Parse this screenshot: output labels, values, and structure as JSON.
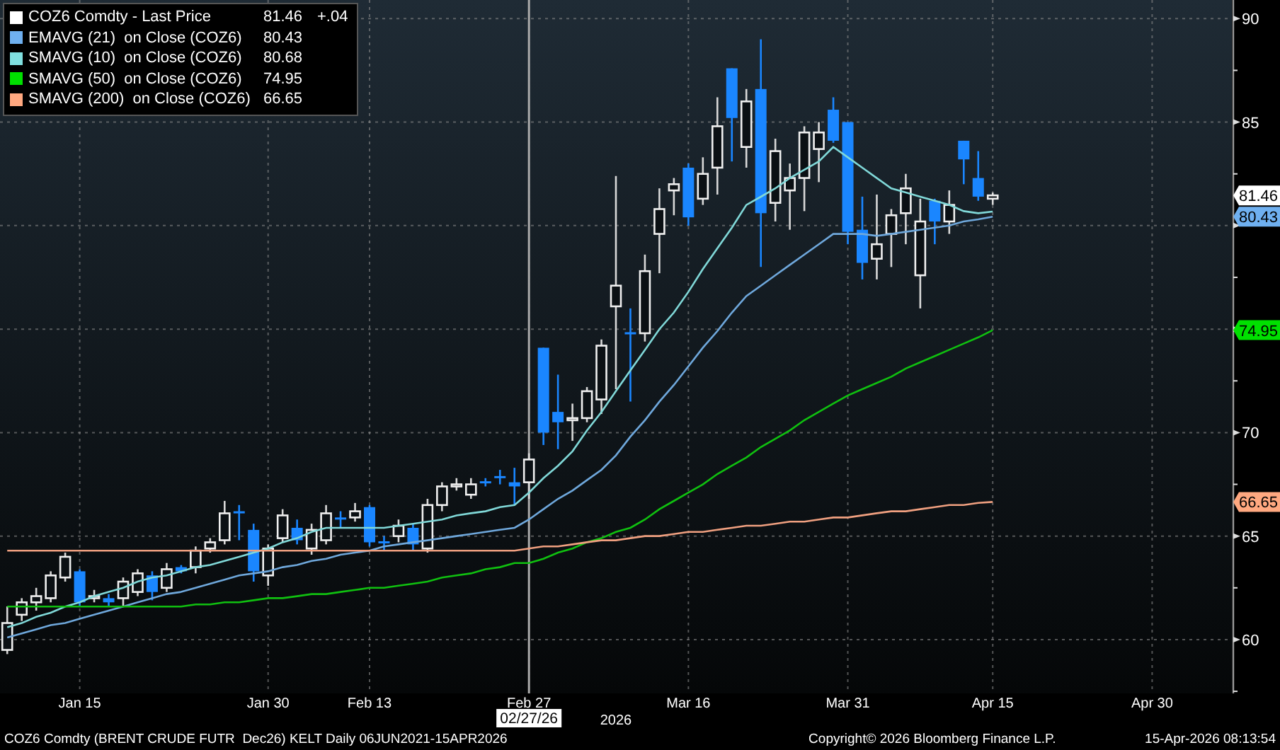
{
  "legend": {
    "items": [
      {
        "label": "COZ6 Comdty - Last Price",
        "value": "81.46",
        "change": "+.04",
        "color": "#ffffff",
        "tag": "81.46"
      },
      {
        "text": "on Close (COZ6)",
        "value": "80.43",
        "color": "#6fb0f0",
        "tag": "80.43"
      },
      {
        "text": "on Close (COZ6)",
        "value": "80.68",
        "color": "#80e0e0"
      },
      {
        "text": "on Close (COZ6)",
        "value": "74.95",
        "color": "#00e000",
        "tag": "74.95"
      },
      {
        "text": "on Close (COZ6)",
        "value": "66.65",
        "color": "#ffa880",
        "tag": "66.65"
      }
    ]
  },
  "chart_data": {
    "type": "candlestick",
    "ylim": [
      57.4,
      90.9
    ],
    "grid": true,
    "categories": [
      null,
      null,
      null,
      null,
      null,
      "Jan 15",
      null,
      null,
      null,
      null,
      null,
      null,
      null,
      null,
      null,
      null,
      null,
      null,
      "Jan 30",
      null,
      null,
      null,
      null,
      null,
      null,
      "Feb 13",
      null,
      null,
      null,
      null,
      null,
      null,
      null,
      null,
      null,
      null,
      "Feb 27",
      null,
      null,
      null,
      null,
      null,
      null,
      null,
      null,
      null,
      null,
      "Mar 16",
      null,
      null,
      null,
      null,
      null,
      null,
      null,
      null,
      null,
      null,
      "Mar 31",
      null,
      null,
      null,
      null,
      null,
      null,
      null,
      null,
      null,
      "Apr 15",
      null,
      null,
      null,
      null,
      null,
      null,
      null,
      null,
      null,
      null,
      "Apr 30",
      null,
      null,
      null,
      null,
      null
    ],
    "yticks": [
      60,
      65,
      70,
      85,
      90
    ],
    "ohlc": [
      [
        59.5,
        61.6,
        59.3,
        60.8
      ],
      [
        61.2,
        62.0,
        60.9,
        61.8
      ],
      [
        61.8,
        62.5,
        61.4,
        62.1
      ],
      [
        62.0,
        63.3,
        61.8,
        63.1
      ],
      [
        63.0,
        64.2,
        62.8,
        64.0
      ],
      [
        63.3,
        63.4,
        61.6,
        61.8
      ],
      [
        62.0,
        62.4,
        61.8,
        62.1
      ],
      [
        62.0,
        62.2,
        61.6,
        61.8
      ],
      [
        62.0,
        63.0,
        61.6,
        62.8
      ],
      [
        62.3,
        63.4,
        62.1,
        63.2
      ],
      [
        63.1,
        63.3,
        61.9,
        62.3
      ],
      [
        62.5,
        63.7,
        62.3,
        63.4
      ],
      [
        63.5,
        63.6,
        63.2,
        63.3
      ],
      [
        63.5,
        64.5,
        63.2,
        64.3
      ],
      [
        64.4,
        64.9,
        64.2,
        64.7
      ],
      [
        64.8,
        66.7,
        64.6,
        66.1
      ],
      [
        66.2,
        66.5,
        64.8,
        66.1
      ],
      [
        65.3,
        65.6,
        62.8,
        63.3
      ],
      [
        63.1,
        64.6,
        62.6,
        64.4
      ],
      [
        64.9,
        66.3,
        64.7,
        66.0
      ],
      [
        65.4,
        65.8,
        64.6,
        64.8
      ],
      [
        64.4,
        65.6,
        64.1,
        65.3
      ],
      [
        64.8,
        66.5,
        64.6,
        66.1
      ],
      [
        65.9,
        66.2,
        65.4,
        65.8
      ],
      [
        65.9,
        66.6,
        65.7,
        66.2
      ],
      [
        66.4,
        66.5,
        64.5,
        64.7
      ],
      [
        64.75,
        65.0,
        64.3,
        64.7
      ],
      [
        65.0,
        65.8,
        64.7,
        65.5
      ],
      [
        65.4,
        65.6,
        64.3,
        64.6
      ],
      [
        64.4,
        66.8,
        64.2,
        66.5
      ],
      [
        66.5,
        67.6,
        66.2,
        67.4
      ],
      [
        67.4,
        67.8,
        67.2,
        67.5
      ],
      [
        67.0,
        67.8,
        66.8,
        67.5
      ],
      [
        67.65,
        67.8,
        67.4,
        67.6
      ],
      [
        67.9,
        68.2,
        67.5,
        67.8
      ],
      [
        67.6,
        68.3,
        66.5,
        67.4
      ],
      [
        67.6,
        69.0,
        66.8,
        68.7
      ],
      [
        74.1,
        74.1,
        69.4,
        70.0
      ],
      [
        71.0,
        72.8,
        69.2,
        70.5
      ],
      [
        70.6,
        71.4,
        69.6,
        70.7
      ],
      [
        70.7,
        72.2,
        70.5,
        72.0
      ],
      [
        71.6,
        74.5,
        70.9,
        74.2
      ],
      [
        76.1,
        82.4,
        72.1,
        77.1
      ],
      [
        74.85,
        76.0,
        71.5,
        74.75
      ],
      [
        74.8,
        78.6,
        74.4,
        77.8
      ],
      [
        79.6,
        81.8,
        77.7,
        80.8
      ],
      [
        81.7,
        82.3,
        80.5,
        82.0
      ],
      [
        82.8,
        83.0,
        80.0,
        80.4
      ],
      [
        81.3,
        83.3,
        81.0,
        82.5
      ],
      [
        82.8,
        86.2,
        81.5,
        84.8
      ],
      [
        87.6,
        87.6,
        83.1,
        85.2
      ],
      [
        83.8,
        86.6,
        82.8,
        86.0
      ],
      [
        86.6,
        89.0,
        78.0,
        80.6
      ],
      [
        81.1,
        84.2,
        80.2,
        83.6
      ],
      [
        81.7,
        83.0,
        79.8,
        82.3
      ],
      [
        82.3,
        84.8,
        80.7,
        84.5
      ],
      [
        83.7,
        85.0,
        82.1,
        84.5
      ],
      [
        85.6,
        86.2,
        84.0,
        84.1
      ],
      [
        85.0,
        85.0,
        79.1,
        79.7
      ],
      [
        79.8,
        81.4,
        77.4,
        78.2
      ],
      [
        78.4,
        81.5,
        77.4,
        79.1
      ],
      [
        79.6,
        80.8,
        78.0,
        80.5
      ],
      [
        80.6,
        82.5,
        79.1,
        81.8
      ],
      [
        77.6,
        81.3,
        76.0,
        80.2
      ],
      [
        81.2,
        81.3,
        79.1,
        80.2
      ],
      [
        80.2,
        81.7,
        79.6,
        81.0
      ],
      [
        84.1,
        84.1,
        82.0,
        83.2
      ],
      [
        82.3,
        83.6,
        81.2,
        81.4
      ],
      [
        81.3,
        81.6,
        81.0,
        81.46
      ],
      null,
      null,
      null,
      null,
      null,
      null,
      null,
      null,
      null,
      null,
      null,
      null,
      null,
      null,
      null,
      null
    ],
    "annotations": [
      "02/27/26"
    ]
  },
  "moving_averages": {
    "chart_data": {
      "type": "line",
      "ylim": [
        57.4,
        90.9
      ],
      "categories": [
        null,
        null,
        null,
        null,
        null,
        null,
        null,
        null,
        null,
        null,
        null,
        null,
        null,
        null,
        null,
        null,
        null,
        null,
        null,
        null,
        null,
        null,
        null,
        null,
        null,
        null,
        null,
        null,
        null,
        null,
        null,
        null,
        null,
        null,
        null,
        null,
        null,
        null,
        null,
        null,
        null,
        null,
        null,
        null,
        null,
        null,
        null,
        null,
        null,
        null,
        null,
        null,
        null,
        null,
        null,
        null,
        null,
        null,
        null,
        null,
        null,
        null,
        null,
        null,
        null,
        null,
        null,
        null,
        null,
        null,
        null,
        null,
        null,
        null,
        null,
        null,
        null,
        null,
        null,
        null,
        null,
        null,
        null,
        null,
        null
      ],
      "series": [
        {
          "name": "EMAVG (21)",
          "color": "#6fa8dc",
          "values": [
            60.1,
            60.3,
            60.5,
            60.7,
            60.8,
            61.0,
            61.2,
            61.4,
            61.6,
            61.8,
            62.0,
            62.2,
            62.3,
            62.5,
            62.7,
            62.9,
            63.1,
            63.2,
            63.3,
            63.5,
            63.6,
            63.8,
            63.9,
            64.1,
            64.2,
            64.3,
            64.5,
            64.6,
            64.7,
            64.8,
            64.9,
            65.0,
            65.1,
            65.2,
            65.3,
            65.4,
            65.8,
            66.3,
            66.8,
            67.2,
            67.7,
            68.2,
            68.9,
            69.8,
            70.6,
            71.5,
            72.3,
            73.2,
            74.1,
            74.9,
            75.8,
            76.6,
            77.1,
            77.6,
            78.1,
            78.6,
            79.1,
            79.6,
            79.6,
            79.6,
            79.5,
            79.6,
            79.7,
            79.8,
            79.9,
            80.0,
            80.2,
            80.3,
            80.43,
            null,
            null,
            null,
            null,
            null,
            null,
            null,
            null,
            null,
            null,
            null,
            null,
            null,
            null,
            null,
            null
          ]
        },
        {
          "name": "SMAVG (10)",
          "color": "#80d8d8",
          "values": [
            60.6,
            60.8,
            61.1,
            61.3,
            61.6,
            61.8,
            62.1,
            62.3,
            62.5,
            62.8,
            63.0,
            63.1,
            63.3,
            63.5,
            63.6,
            63.8,
            64.0,
            64.2,
            64.4,
            64.7,
            64.9,
            65.2,
            65.4,
            65.4,
            65.4,
            65.4,
            65.4,
            65.5,
            65.6,
            65.7,
            65.8,
            66.0,
            66.1,
            66.2,
            66.4,
            66.5,
            67.1,
            67.8,
            68.4,
            69.1,
            70.1,
            71.0,
            72.0,
            73.0,
            74.0,
            75.0,
            75.8,
            76.8,
            77.9,
            78.9,
            79.9,
            81.0,
            81.4,
            81.8,
            82.3,
            82.7,
            83.1,
            83.8,
            83.3,
            82.8,
            82.3,
            81.8,
            81.6,
            81.4,
            81.2,
            81.0,
            80.7,
            80.6,
            80.68,
            null,
            null,
            null,
            null,
            null,
            null,
            null,
            null,
            null,
            null,
            null,
            null,
            null,
            null,
            null,
            null
          ]
        },
        {
          "name": "SMAVG (50)",
          "color": "#10c010",
          "values": [
            61.6,
            61.6,
            61.6,
            61.6,
            61.6,
            61.6,
            61.6,
            61.6,
            61.6,
            61.6,
            61.6,
            61.6,
            61.6,
            61.7,
            61.7,
            61.8,
            61.8,
            61.9,
            62.0,
            62.0,
            62.1,
            62.2,
            62.2,
            62.3,
            62.4,
            62.5,
            62.5,
            62.6,
            62.7,
            62.8,
            63.0,
            63.1,
            63.2,
            63.4,
            63.5,
            63.7,
            63.7,
            63.9,
            64.2,
            64.4,
            64.7,
            64.9,
            65.2,
            65.4,
            65.8,
            66.3,
            66.7,
            67.1,
            67.5,
            68.0,
            68.4,
            68.8,
            69.3,
            69.7,
            70.1,
            70.6,
            71.0,
            71.4,
            71.8,
            72.1,
            72.4,
            72.7,
            73.1,
            73.4,
            73.7,
            74.0,
            74.3,
            74.6,
            74.95,
            null,
            null,
            null,
            null,
            null,
            null,
            null,
            null,
            null,
            null,
            null,
            null,
            null,
            null,
            null,
            null
          ]
        },
        {
          "name": "SMAVG (200)",
          "color": "#f0a080",
          "values": [
            64.3,
            64.3,
            64.3,
            64.3,
            64.3,
            64.3,
            64.3,
            64.3,
            64.3,
            64.3,
            64.3,
            64.3,
            64.3,
            64.3,
            64.3,
            64.3,
            64.3,
            64.3,
            64.3,
            64.3,
            64.3,
            64.3,
            64.3,
            64.3,
            64.3,
            64.3,
            64.3,
            64.3,
            64.3,
            64.3,
            64.3,
            64.3,
            64.3,
            64.3,
            64.3,
            64.3,
            64.4,
            64.5,
            64.5,
            64.6,
            64.7,
            64.8,
            64.8,
            64.9,
            65.0,
            65.0,
            65.1,
            65.2,
            65.2,
            65.3,
            65.4,
            65.5,
            65.5,
            65.6,
            65.7,
            65.7,
            65.8,
            65.9,
            65.9,
            66.0,
            66.1,
            66.2,
            66.2,
            66.3,
            66.4,
            66.5,
            66.5,
            66.6,
            66.65,
            null,
            null,
            null,
            null,
            null,
            null,
            null,
            null,
            null,
            null,
            null,
            null,
            null,
            null,
            null,
            null
          ]
        }
      ]
    }
  },
  "year_label": "2026",
  "footer": {
    "description": "COZ6 Comdty (BRENT CRUDE FUTR  Dec26) KELT Daily 06JUN2021-15APR2026",
    "copyright": "Copyright© 2026 Bloomberg Finance L.P.",
    "timestamp": "15-Apr-2026 08:13:54"
  }
}
